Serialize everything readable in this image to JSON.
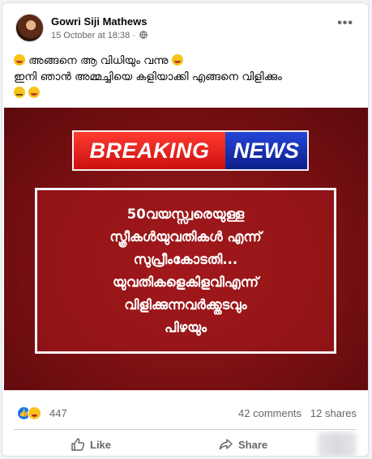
{
  "post": {
    "author": "Gowri Siji Mathews",
    "timestamp": "15 October at 18:38 ·",
    "caption_lines": [
      "അങ്ങനെ ആ വിധിയും വന്നു",
      "ഇനി ഞാൻ അമ്മച്ചിയെ കളിയാക്കി എങ്ങനെ വിളിക്കും"
    ],
    "image": {
      "banner_left": "BREAKING",
      "banner_right": "NEWS",
      "lines": [
        "50വയസ്സ്വരെയുള്ള",
        "സ്ത്രീകൾയുവതികൾ എന്ന്",
        "സുപ്രീംകോടതി...",
        "യുവതികളെകിളവിഎന്ന്",
        "വിളിക്കുന്നവർക്ക്തടവും",
        "പിഴയും"
      ],
      "colors": {
        "background": "#7a1013",
        "breaking": "#e0201a",
        "news": "#1a33b8"
      }
    },
    "reaction_count": "447",
    "comments": "42 comments",
    "shares": "12 shares",
    "actions": {
      "like": "Like",
      "share": "Share"
    }
  }
}
